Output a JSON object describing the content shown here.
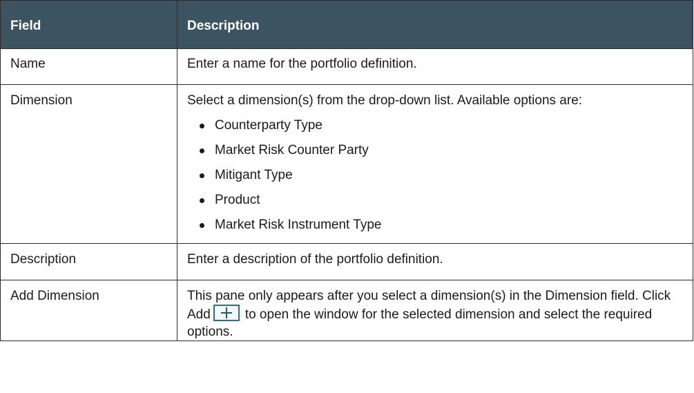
{
  "table": {
    "headers": {
      "field": "Field",
      "description": "Description"
    },
    "rows": {
      "name": {
        "field": "Name",
        "description": "Enter a name for the portfolio definition."
      },
      "dimension": {
        "field": "Dimension",
        "description": "Select a dimension(s) from the drop-down list. Available options are:",
        "options": [
          "Counterparty Type",
          "Market Risk Counter Party",
          "Mitigant Type",
          "Product",
          "Market Risk Instrument Type"
        ]
      },
      "description": {
        "field": "Description",
        "description": "Enter a description of the portfolio definition."
      },
      "add_dimension": {
        "field": "Add Dimension",
        "description_before_icon": "This pane only appears after you select a dimension(s) in the Dimension field. Click Add",
        "icon": "plus-icon",
        "description_after_icon": "to open the window for the selected dimension and select the required options."
      }
    },
    "colors": {
      "header_bg": "#3c5461",
      "header_text": "#ffffff",
      "icon_accent": "#2c6e85"
    }
  }
}
